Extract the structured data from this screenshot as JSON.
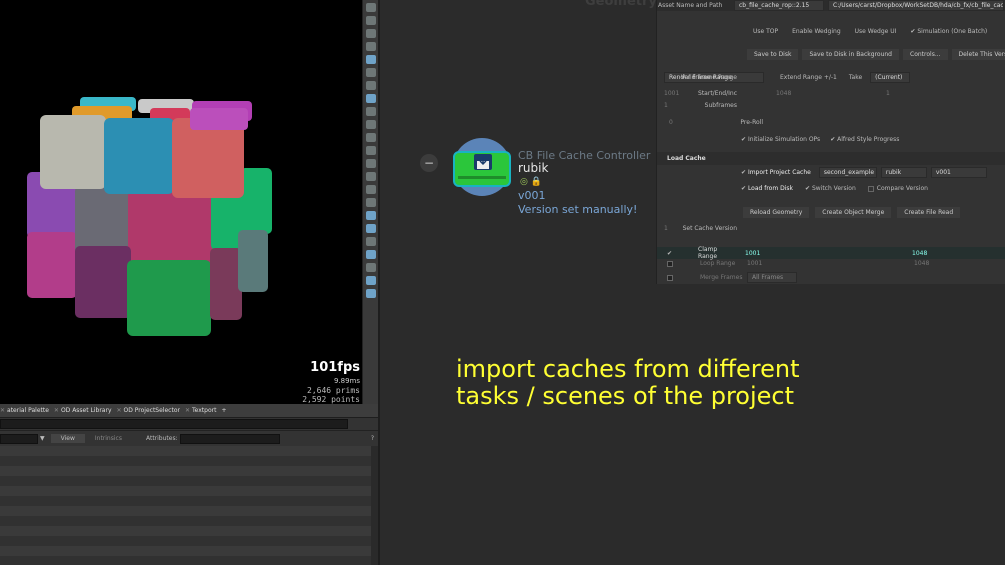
{
  "viewport": {
    "fps": "101fps",
    "ms": "9.89ms",
    "prims": "2,646  prims",
    "points": "2,592  points"
  },
  "bottom_tabs": [
    "aterial Palette",
    "OD Asset Library",
    "OD ProjectSelector",
    "Textport"
  ],
  "spreadsheet": {
    "view_label": "View",
    "intrinsics_label": "Intrinsics",
    "attributes_label": "Attributes:"
  },
  "network": {
    "ghost_label": "Geometry",
    "node_title": "CB File Cache Controller",
    "node_name": "rubik",
    "node_version": "v001",
    "node_message": "Version set manually!"
  },
  "caption": {
    "line1": "import caches from different",
    "line2": "tasks / scenes of the project"
  },
  "params": {
    "asset_label": "Asset Name and Path",
    "asset_name": "cb_file_cache_rop::2.15",
    "asset_path": "C:/Users/carst/Dropbox/WorkSetDB/hda/cb_fx/cb_file_cache",
    "use_top": "Use TOP",
    "enable_wedging": "Enable Wedging",
    "use_wedge_ui": "Use Wedge UI",
    "simulation": "Simulation (One Batch)",
    "save_to_disk": "Save to Disk",
    "save_bg": "Save to Disk in Background",
    "controls": "Controls...",
    "delete_version": "Delete This Version",
    "valid_range_label": "Valid Frame Range",
    "valid_range_value": "Render Frame Range",
    "extend_range": "Extend Range +/-1",
    "take_label": "Take",
    "take_value": "(Current)",
    "start_end_label": "Start/End/Inc",
    "start": "1001",
    "end": "1048",
    "inc": "1",
    "subframes_label": "Subframes",
    "subframes": "1",
    "preroll_label": "Pre-Roll",
    "preroll": "0",
    "init_sim": "Initialize Simulation OPs",
    "alfred": "Alfred Style Progress",
    "load_cache_section": "Load Cache",
    "import_project_cache": "Import Project Cache",
    "import_scene": "second_example",
    "import_name": "rubik",
    "import_version": "v001",
    "load_from_disk": "Load from Disk",
    "switch_version": "Switch Version",
    "compare_version": "Compare Version",
    "reload_geometry": "Reload Geometry",
    "create_object_merge": "Create Object Merge",
    "create_file_read": "Create File Read",
    "set_cache_version_label": "Set Cache Version",
    "set_cache_version": "1",
    "clamp_range_label": "Clamp Range",
    "clamp_start": "1001",
    "clamp_end": "1048",
    "loop_range_label": "Loop Range",
    "loop_start": "1001",
    "loop_end": "1048",
    "merge_frames_label": "Merge Frames",
    "merge_frames_value": "All Frames"
  }
}
